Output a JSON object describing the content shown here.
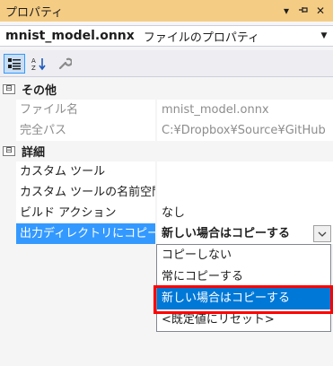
{
  "window": {
    "title": "プロパティ",
    "controls": [
      "dropdown",
      "pin",
      "close"
    ]
  },
  "object_selector": {
    "name": "mnist_model.onnx",
    "type": "ファイルのプロパティ"
  },
  "toolbar": {
    "buttons": [
      {
        "icon": "categorized-icon",
        "active": true
      },
      {
        "icon": "alphabetical-icon",
        "active": false
      },
      {
        "icon": "wrench-icon",
        "active": false
      }
    ]
  },
  "categories": [
    {
      "label": "その他",
      "toggle": "⊟",
      "properties": [
        {
          "name": "ファイル名",
          "value": "mnist_model.onnx"
        },
        {
          "name": "完全パス",
          "value": "C:¥Dropbox¥Source¥GitHub"
        }
      ]
    },
    {
      "label": "詳細",
      "toggle": "⊟",
      "properties": [
        {
          "name": "カスタム ツール",
          "value": ""
        },
        {
          "name": "カスタム ツールの名前空間",
          "value": ""
        },
        {
          "name": "ビルド アクション",
          "value": "なし"
        },
        {
          "name": "出力ディレクトリにコピー",
          "value": "新しい場合はコピーする"
        }
      ]
    }
  ],
  "dropdown": {
    "options": [
      "コピーしない",
      "常にコピーする",
      "新しい場合はコピーする",
      "<既定値にリセット>"
    ],
    "highlighted_index": 2
  },
  "colors": {
    "titlebar": "#f5cc84",
    "selection": "#3399ff",
    "highlight": "#0078d7",
    "annotation": "#ff0000"
  }
}
